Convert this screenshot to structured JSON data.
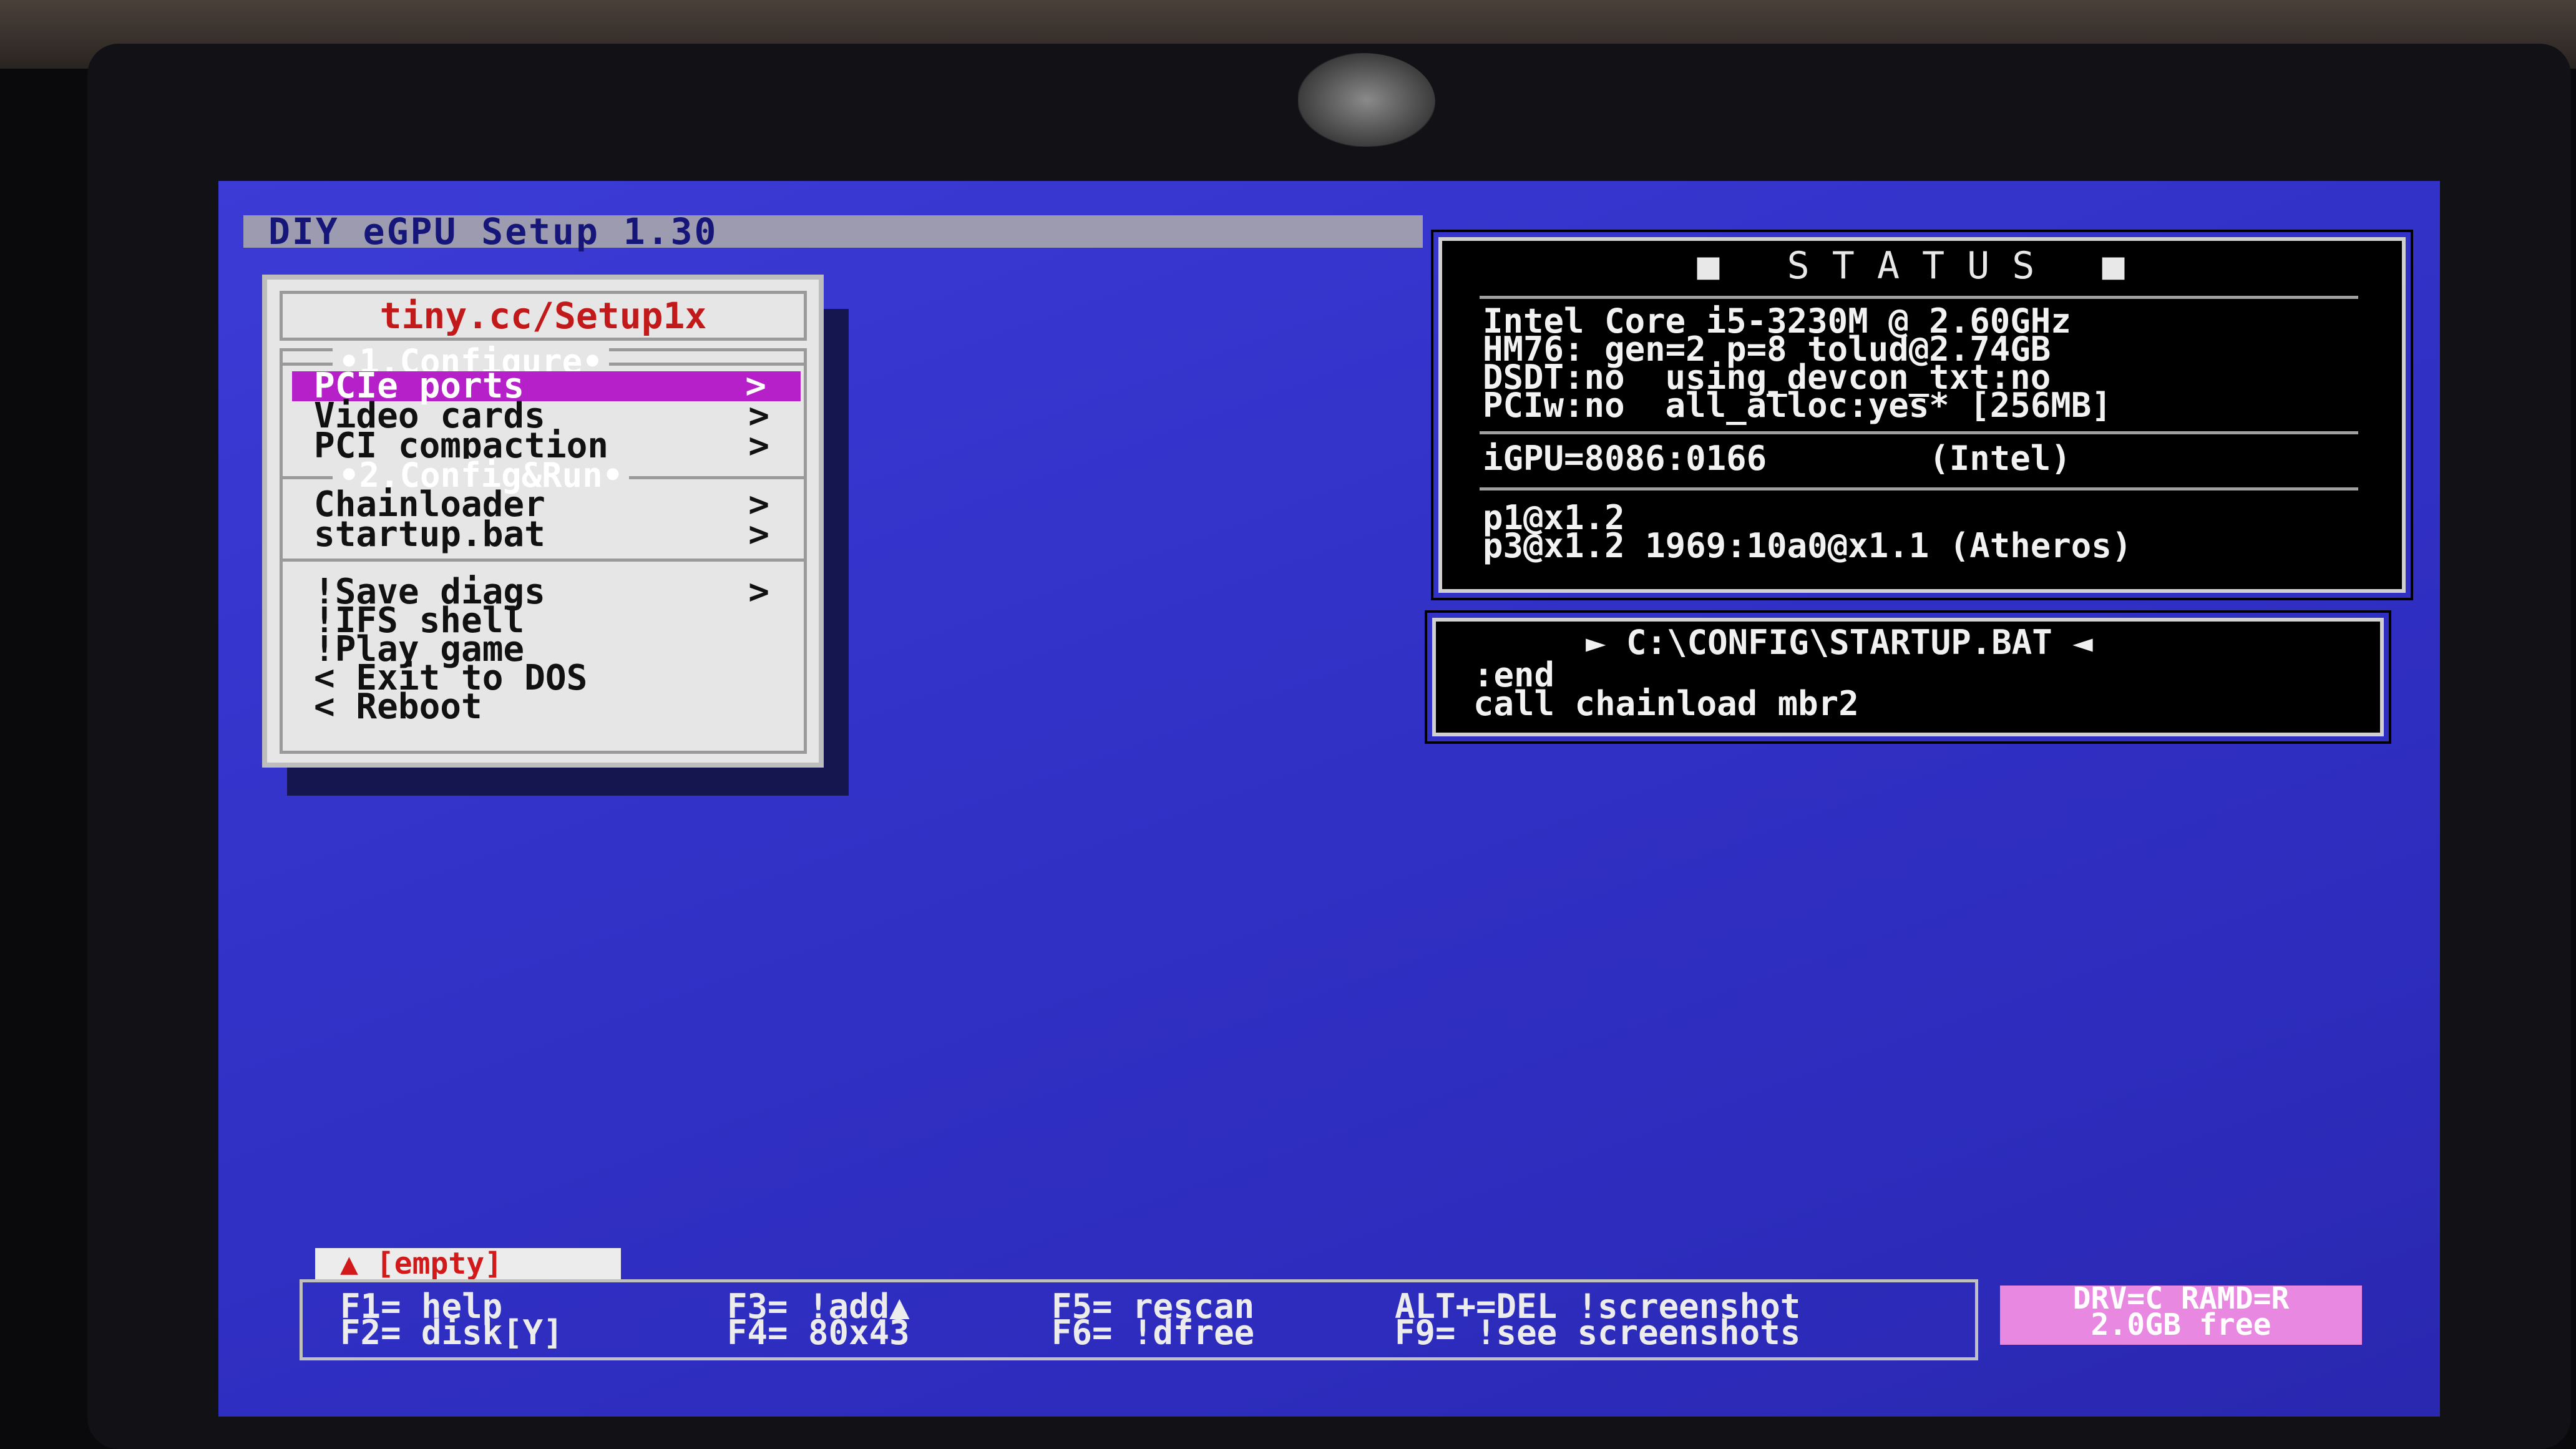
{
  "app_title": "DIY eGPU Setup 1.30",
  "menu": {
    "title": "tiny.cc/Setup1x",
    "section1": "•1.Configure•",
    "section2": "•2.Config&Run•",
    "items": [
      {
        "label": "PCIe ports",
        "arrow": ">"
      },
      {
        "label": "Video cards",
        "arrow": ">"
      },
      {
        "label": "PCI compaction",
        "arrow": ">"
      },
      {
        "label": "Chainloader",
        "arrow": ">"
      },
      {
        "label": "startup.bat",
        "arrow": ">"
      },
      {
        "label": "!Save diags",
        "arrow": ">"
      },
      {
        "label": "!IFS shell",
        "arrow": ""
      },
      {
        "label": "!Play game",
        "arrow": ""
      },
      {
        "label": "< Exit to DOS",
        "arrow": ""
      },
      {
        "label": "< Reboot",
        "arrow": ""
      }
    ],
    "selected_index": 0
  },
  "status": {
    "heading": "■ STATUS ■",
    "lines": [
      "Intel Core i5-3230M @ 2.60GHz",
      "HM76: gen=2 p=8 tolud@2.74GB",
      "DSDT:no  using_devcon_txt:no",
      "PCIw:no  all_alloc:yes* [256MB]"
    ],
    "igpu": "iGPU=8086:0166        (Intel)",
    "ports": [
      "p1@x1.2",
      "p3@x1.2 1969:10a0@x1.1 (Atheros)"
    ]
  },
  "startup": {
    "heading": "► C:\\CONFIG\\STARTUP.BAT ◄",
    "lines": [
      ":end",
      "call chainload mbr2"
    ]
  },
  "empty_tag": "▲ [empty]",
  "fkeys": {
    "f1": "F1= help",
    "f2": "F2= disk[Y]",
    "f3": "F3= !add▲",
    "f4": "F4= 80x43",
    "f5": "F5= rescan",
    "f6": "F6= !dfree",
    "altdel": "ALT+=DEL !screenshot",
    "f9": "F9= !see screenshots"
  },
  "drive": {
    "line1": "DRV=C RAMD=R",
    "line2": "2.0GB free"
  },
  "colors": {
    "screen_bg": "#3232c8",
    "selection": "#b520c8",
    "menu_title": "#c21a1a",
    "drive_box": "#e888e0"
  }
}
